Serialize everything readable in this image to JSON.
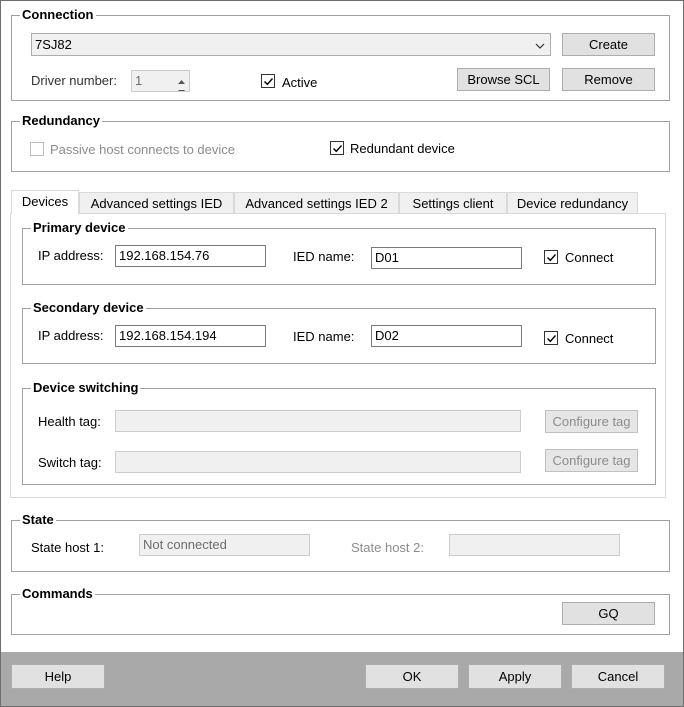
{
  "connection": {
    "title": "Connection",
    "device_select": "7SJ82",
    "create_label": "Create",
    "driver_label": "Driver number:",
    "driver_value": "1",
    "active_label": "Active",
    "active_checked": true,
    "browse_label": "Browse SCL",
    "remove_label": "Remove"
  },
  "redundancy": {
    "title": "Redundancy",
    "passive_label": "Passive host connects to device",
    "passive_checked": false,
    "redundant_label": "Redundant device",
    "redundant_checked": true
  },
  "tabs": [
    {
      "label": "Devices",
      "active": true
    },
    {
      "label": "Advanced settings IED",
      "active": false
    },
    {
      "label": "Advanced settings IED 2",
      "active": false
    },
    {
      "label": "Settings client",
      "active": false
    },
    {
      "label": "Device redundancy",
      "active": false
    }
  ],
  "primary": {
    "title": "Primary device",
    "ip_label": "IP address:",
    "ip_value": "192.168.154.76",
    "ied_label": "IED name:",
    "ied_value": "D01",
    "connect_label": "Connect",
    "connect_checked": true
  },
  "secondary": {
    "title": "Secondary device",
    "ip_label": "IP address:",
    "ip_value": "192.168.154.194",
    "ied_label": "IED name:",
    "ied_value": "D02",
    "connect_label": "Connect",
    "connect_checked": true
  },
  "switching": {
    "title": "Device switching",
    "health_label": "Health tag:",
    "health_value": "",
    "switch_label": "Switch tag:",
    "switch_value": "",
    "configure_label": "Configure tag"
  },
  "state": {
    "title": "State",
    "host1_label": "State host 1:",
    "host1_value": "Not connected",
    "host2_label": "State host 2:",
    "host2_value": ""
  },
  "commands": {
    "title": "Commands",
    "gq_label": "GQ"
  },
  "footer": {
    "help_label": "Help",
    "ok_label": "OK",
    "apply_label": "Apply",
    "cancel_label": "Cancel"
  },
  "icons": {
    "check": "check-icon",
    "dropdown": "chevron-down-icon",
    "spin_up": "chevron-up-icon",
    "spin_down": "chevron-down-icon"
  }
}
